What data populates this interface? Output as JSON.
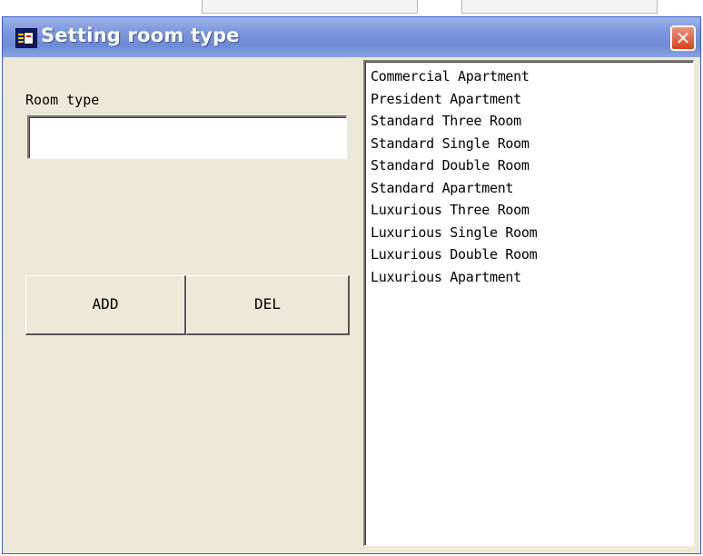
{
  "window": {
    "title": "Setting room type",
    "close_glyph": "✕",
    "icon": "app-database-icon"
  },
  "form": {
    "room_type_label": "Room type",
    "room_type_value": "",
    "add_label": "ADD",
    "del_label": "DEL"
  },
  "room_types": [
    "Commercial Apartment",
    "President Apartment",
    "Standard Three Room",
    "Standard Single Room",
    "Standard Double Room",
    "Standard Apartment",
    "Luxurious Three Room",
    "Luxurious Single Room",
    "Luxurious Double Room",
    "Luxurious Apartment"
  ],
  "colors": {
    "titlebar": "#7d98dc",
    "dialog_background": "#ece9d8",
    "close_button": "#d8421c"
  }
}
